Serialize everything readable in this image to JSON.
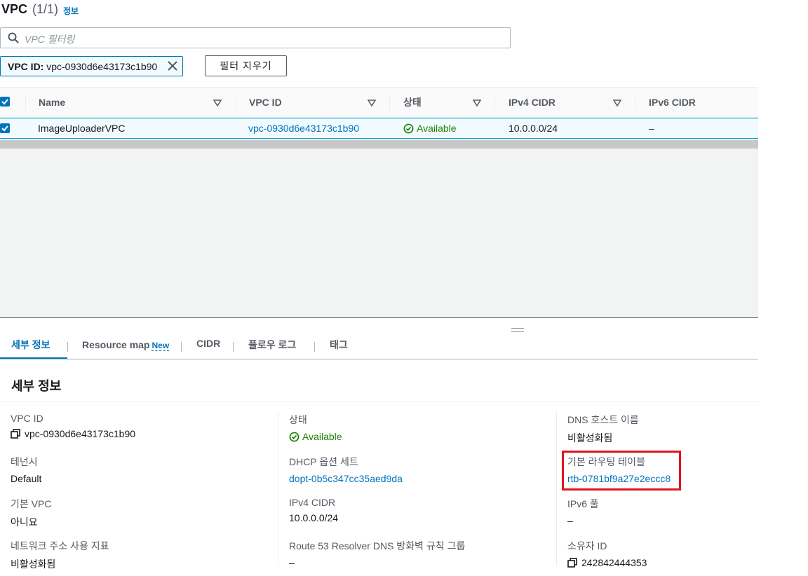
{
  "header": {
    "title": "VPC",
    "count": "(1/1)",
    "info_link": "정보"
  },
  "search": {
    "placeholder": "VPC 필터링"
  },
  "filter_token": {
    "key": "VPC ID:",
    "value": "vpc-0930d6e43173c1b90"
  },
  "clear_filters_label": "필터 지우기",
  "table": {
    "columns": [
      "Name",
      "VPC ID",
      "상태",
      "IPv4 CIDR",
      "IPv6 CIDR"
    ],
    "rows": [
      {
        "name": "ImageUploaderVPC",
        "vpc_id": "vpc-0930d6e43173c1b90",
        "status": "Available",
        "ipv4_cidr": "10.0.0.0/24",
        "ipv6_cidr": "–"
      }
    ]
  },
  "tabs": [
    {
      "label": "세부 정보",
      "active": true
    },
    {
      "label": "Resource map",
      "badge": "New"
    },
    {
      "label": "CIDR"
    },
    {
      "label": "플로우 로그"
    },
    {
      "label": "태그"
    }
  ],
  "details": {
    "title": "세부 정보",
    "col1": [
      {
        "label": "VPC ID",
        "value": "vpc-0930d6e43173c1b90",
        "icon": "copy-icon"
      },
      {
        "label": "테넌시",
        "value": "Default"
      },
      {
        "label": "기본 VPC",
        "value": "아니요"
      },
      {
        "label": "네트워크 주소 사용 지표",
        "value": "비활성화됨"
      }
    ],
    "col2": [
      {
        "label": "상태",
        "value": "Available",
        "icon": "check-circle-icon"
      },
      {
        "label": "DHCP 옵션 세트",
        "value": "dopt-0b5c347cc35aed9da"
      },
      {
        "label": "IPv4 CIDR",
        "value": "10.0.0.0/24"
      },
      {
        "label": "Route 53 Resolver DNS 방화벽 규칙 그룹",
        "value": "–"
      }
    ],
    "col3": [
      {
        "label": "DNS 호스트 이름",
        "value": "비활성화됨"
      },
      {
        "label": "기본 라우팅 테이블",
        "value": "rtb-0781bf9a27e2eccc8"
      },
      {
        "label": "IPv6 풀",
        "value": "–"
      },
      {
        "label": "소유자 ID",
        "value": "242842444353",
        "icon": "copy-icon"
      }
    ]
  },
  "colors": {
    "link": "#0073bb",
    "success": "#1d8102",
    "highlight": "#e0141e"
  }
}
